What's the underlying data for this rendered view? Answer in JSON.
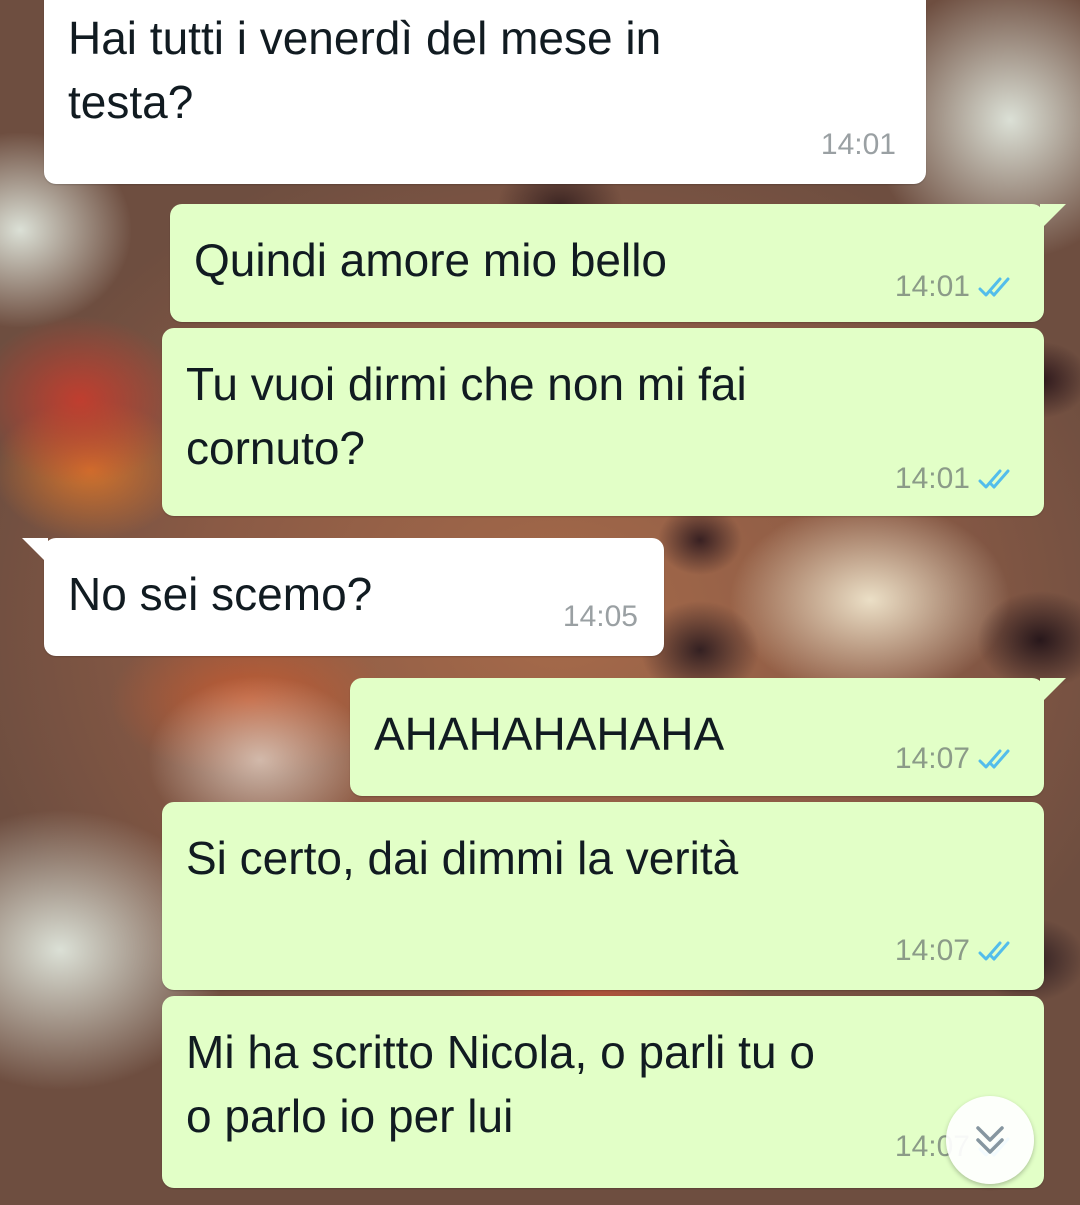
{
  "messages": [
    {
      "direction": "incoming",
      "text": "Hai tutti i venerdì del mese in\ntesta?",
      "time": "14:01"
    },
    {
      "direction": "outgoing",
      "text": "Quindi amore mio bello",
      "time": "14:01",
      "status": "read"
    },
    {
      "direction": "outgoing",
      "text": "Tu vuoi dirmi che non mi fai\ncornuto?",
      "time": "14:01",
      "status": "read"
    },
    {
      "direction": "incoming",
      "text": "No sei scemo?",
      "time": "14:05"
    },
    {
      "direction": "outgoing",
      "text": "AHAHAHAHAHA",
      "time": "14:07",
      "status": "read"
    },
    {
      "direction": "outgoing",
      "text": "Si certo, dai dimmi la verità",
      "time": "14:07",
      "status": "read"
    },
    {
      "direction": "outgoing",
      "text": "Mi ha scritto Nicola, o parli tu o\no parlo io per lui",
      "time": "14:07",
      "status": "read"
    }
  ],
  "colors": {
    "incoming_bubble": "#ffffff",
    "outgoing_bubble": "#e2ffc7",
    "read_ticks": "#53bdeb"
  },
  "icons": {
    "read_status": "double-check-icon",
    "scroll_down": "double-chevron-down-icon"
  }
}
